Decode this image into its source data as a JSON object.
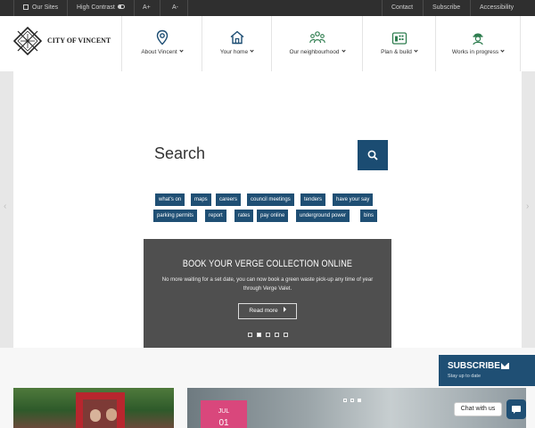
{
  "utility_bar": {
    "our_sites": "Our Sites",
    "high_contrast": "High Contrast",
    "font_increase": "A+",
    "font_decrease": "A-",
    "contact": "Contact",
    "subscribe": "Subscribe",
    "accessibility": "Accessibility"
  },
  "header": {
    "logo_text": "CITY OF VINCENT",
    "nav": [
      {
        "label": "About Vincent",
        "icon": "map-pin-icon"
      },
      {
        "label": "Your home",
        "icon": "house-icon"
      },
      {
        "label": "Our neighbourhood",
        "icon": "people-icon"
      },
      {
        "label": "Plan & build",
        "icon": "buildings-icon"
      },
      {
        "label": "Works in progress",
        "icon": "worker-icon"
      }
    ]
  },
  "search": {
    "label": "Search",
    "tags": [
      "what's on",
      "maps",
      "careers",
      "council meetings",
      "tenders",
      "have your say",
      "parking permits",
      "report",
      "rates",
      "pay online",
      "underground power",
      "bins"
    ]
  },
  "promo": {
    "title": "Book your verge collection online",
    "text": "No more waiting for a set date, you can now book a green waste pick-up any time of year through Verge Valet.",
    "button": "Read more",
    "slides": 5,
    "active_slide": 2
  },
  "news": {
    "date_month": "JUL",
    "date_day": "01",
    "slides": 3,
    "active_slide": 3
  },
  "subscribe_widget": {
    "title": "SUBSCRIBE",
    "subtitle": "Stay up to date"
  },
  "chat": {
    "label": "Chat with us"
  },
  "colors": {
    "navy": "#1f4f74",
    "icon_green": "#2e7d4f",
    "icon_blue": "#1b4c72",
    "dark_bar": "#2f2f2f",
    "promo_bg": "#4f4f4f"
  }
}
